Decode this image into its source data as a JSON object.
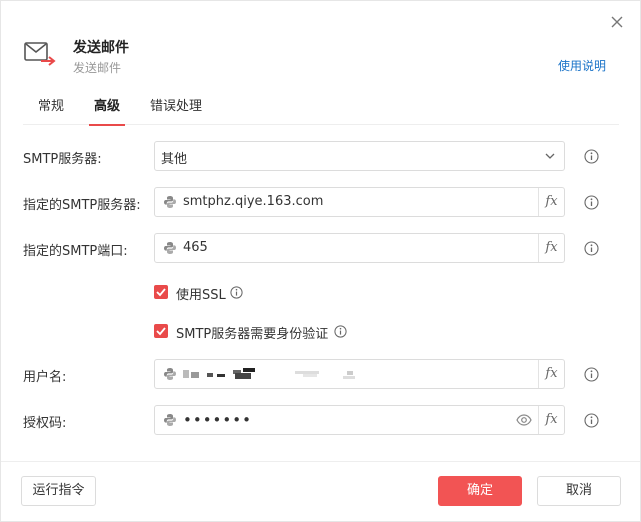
{
  "header": {
    "title": "发送邮件",
    "subtitle": "发送邮件",
    "help_link": "使用说明"
  },
  "tabs": [
    {
      "label": "常规",
      "active": false
    },
    {
      "label": "高级",
      "active": true
    },
    {
      "label": "错误处理",
      "active": false
    }
  ],
  "form": {
    "smtp_server": {
      "label": "SMTP服务器:",
      "value": "其他"
    },
    "custom_server": {
      "label": "指定的SMTP服务器:",
      "value": "smtphz.qiye.163.com"
    },
    "custom_port": {
      "label": "指定的SMTP端口:",
      "value": "465"
    },
    "use_ssl": {
      "label": "使用SSL",
      "checked": true
    },
    "require_auth": {
      "label": "SMTP服务器需要身份验证",
      "checked": true
    },
    "username": {
      "label": "用户名:"
    },
    "auth_code": {
      "label": "授权码:",
      "value": "•••••••"
    },
    "fx_label": "fx"
  },
  "footer": {
    "run_label": "运行指令",
    "ok_label": "确定",
    "cancel_label": "取消"
  },
  "colors": {
    "accent": "#f25454",
    "link": "#1a73c8"
  }
}
